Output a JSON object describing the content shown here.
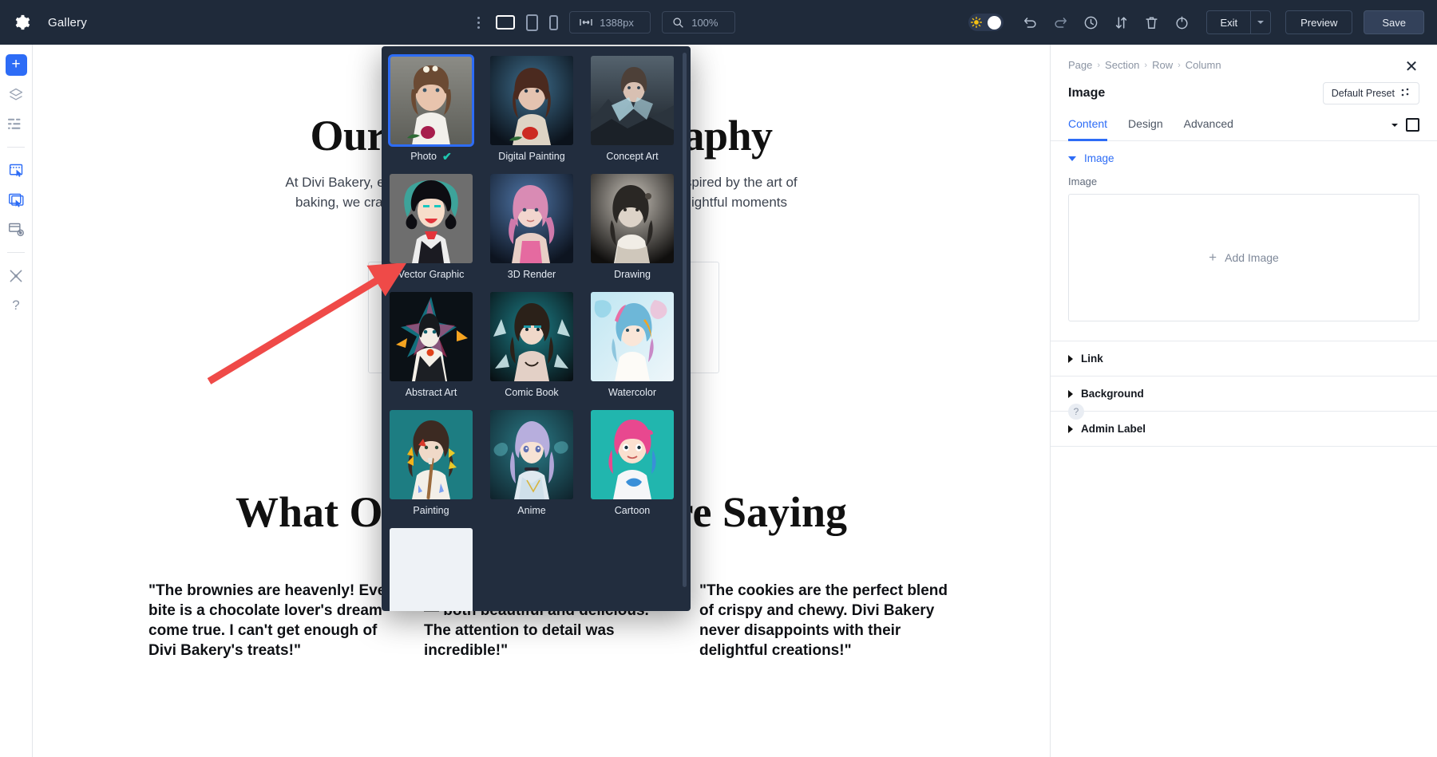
{
  "toolbar": {
    "gear_icon": "gear-icon",
    "app_title": "Gallery",
    "kebab_icon": "more-options-icon",
    "viewport": {
      "desktop": "desktop-view-icon",
      "tablet": "tablet-view-icon",
      "phone": "phone-view-icon"
    },
    "width_value": "1388px",
    "width_icon": "width-arrows-icon",
    "zoom_value": "100%",
    "zoom_icon": "magnifier-icon",
    "theme_toggle_icon": "sun-toggle-icon",
    "undo_icon": "undo-icon",
    "redo_icon": "redo-icon",
    "history_icon": "history-clock-icon",
    "portability_icon": "transfer-arrows-icon",
    "trash_icon": "trash-icon",
    "power_icon": "power-icon",
    "exit_label": "Exit",
    "exit_caret_icon": "chevron-down-icon",
    "preview_label": "Preview",
    "save_label": "Save",
    "accent_blue": "#2d6cf6",
    "bar_bg": "#1f2a3a"
  },
  "left_rail": {
    "items": [
      {
        "name": "add-button",
        "icon": "plus-icon"
      },
      {
        "name": "layers-button",
        "icon": "layers-icon"
      },
      {
        "name": "wireframe-button",
        "icon": "list-lines-icon"
      },
      {
        "name": "select-element-button",
        "icon": "select-element-icon"
      },
      {
        "name": "multi-select-button",
        "icon": "multi-select-icon"
      },
      {
        "name": "responsive-button",
        "icon": "responsive-grid-icon"
      },
      {
        "name": "tools-button",
        "icon": "wrench-cross-icon"
      },
      {
        "name": "help-button",
        "icon": "question-mark-icon"
      }
    ]
  },
  "page": {
    "heading_1": "Our Bakery Photography",
    "subtext": "At Divi Bakery, every bite is a celebration of creativity and flavor. Inspired by the art of baking, we crafted to bring smiles and sweetness to your most delightful moments",
    "heading_2": "What Our Customers Are Saying",
    "testimonials": [
      "\"The brownies are heavenly! Every bite is a chocolate lover's dream come true. I can't get enough of Divi Bakery's treats!\"",
      "\"Our wedding cake was stunning — both beautiful and delicious. The attention to detail was incredible!\"",
      "\"The cookies are the perfect blend of crispy and chewy. Divi Bakery never disappoints with their delightful creations!\""
    ]
  },
  "style_modal": {
    "selected": "Photo",
    "check_color": "#1ec8b0",
    "selection_border": "#2d6cf6",
    "background": "#222d3e",
    "styles": [
      {
        "label": "Photo",
        "selected": true
      },
      {
        "label": "Digital Painting",
        "selected": false
      },
      {
        "label": "Concept Art",
        "selected": false
      },
      {
        "label": "Vector Graphic",
        "selected": false
      },
      {
        "label": "3D Render",
        "selected": false
      },
      {
        "label": "Drawing",
        "selected": false
      },
      {
        "label": "Abstract Art",
        "selected": false
      },
      {
        "label": "Comic Book",
        "selected": false
      },
      {
        "label": "Watercolor",
        "selected": false
      },
      {
        "label": "Painting",
        "selected": false
      },
      {
        "label": "Anime",
        "selected": false
      },
      {
        "label": "Cartoon",
        "selected": false
      }
    ],
    "scrollbar": "vertical-scrollbar"
  },
  "annotation": {
    "arrow_color": "#ef4a48",
    "points_to": "Vector Graphic"
  },
  "right_panel": {
    "breadcrumb": [
      "Page",
      "Section",
      "Row",
      "Column"
    ],
    "separator": "›",
    "close_icon": "close-icon",
    "title": "Image",
    "preset_label": "Default Preset",
    "preset_icon": "preset-dots-icon",
    "tabs": [
      {
        "label": "Content",
        "active": true
      },
      {
        "label": "Design",
        "active": false
      },
      {
        "label": "Advanced",
        "active": false
      }
    ],
    "tabs_caret_icon": "chevron-down-icon",
    "tabs_square_icon": "panel-layout-icon",
    "sections": [
      {
        "label": "Image",
        "open": true
      },
      {
        "label": "Link",
        "open": false
      },
      {
        "label": "Background",
        "open": false
      },
      {
        "label": "Admin Label",
        "open": false
      }
    ],
    "image_field_label": "Image",
    "add_image_label": "Add Image",
    "add_image_plus": "+",
    "help_icon": "question-mark-icon"
  }
}
